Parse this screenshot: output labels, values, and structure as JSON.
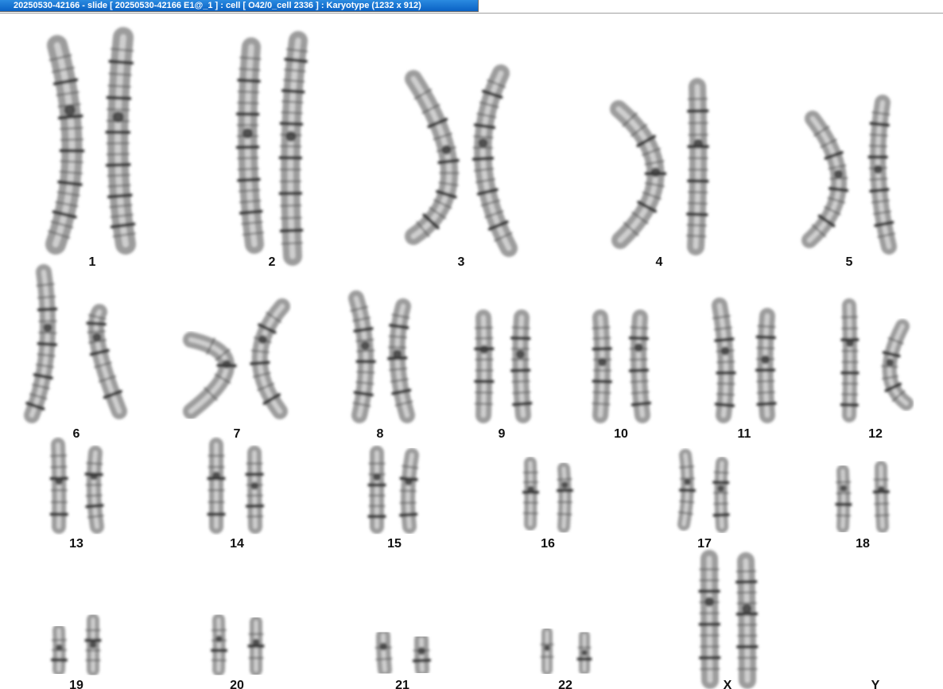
{
  "window": {
    "title": "20250530-42166 - slide [ 20250530-42166 E1@_1 ] : cell [ O42/0_cell 2336 ] : Karyotype  (1232 x 912)"
  },
  "karyotype": {
    "chromosomes": [
      {
        "id": "1",
        "label": "1"
      },
      {
        "id": "2",
        "label": "2"
      },
      {
        "id": "3",
        "label": "3"
      },
      {
        "id": "4",
        "label": "4"
      },
      {
        "id": "5",
        "label": "5"
      },
      {
        "id": "6",
        "label": "6"
      },
      {
        "id": "7",
        "label": "7"
      },
      {
        "id": "8",
        "label": "8"
      },
      {
        "id": "9",
        "label": "9"
      },
      {
        "id": "10",
        "label": "10"
      },
      {
        "id": "11",
        "label": "11"
      },
      {
        "id": "12",
        "label": "12"
      },
      {
        "id": "13",
        "label": "13"
      },
      {
        "id": "14",
        "label": "14"
      },
      {
        "id": "15",
        "label": "15"
      },
      {
        "id": "16",
        "label": "16"
      },
      {
        "id": "17",
        "label": "17"
      },
      {
        "id": "18",
        "label": "18"
      },
      {
        "id": "19",
        "label": "19"
      },
      {
        "id": "20",
        "label": "20"
      },
      {
        "id": "21",
        "label": "21"
      },
      {
        "id": "22",
        "label": "22"
      },
      {
        "id": "X",
        "label": "X"
      },
      {
        "id": "Y",
        "label": "Y"
      }
    ]
  }
}
